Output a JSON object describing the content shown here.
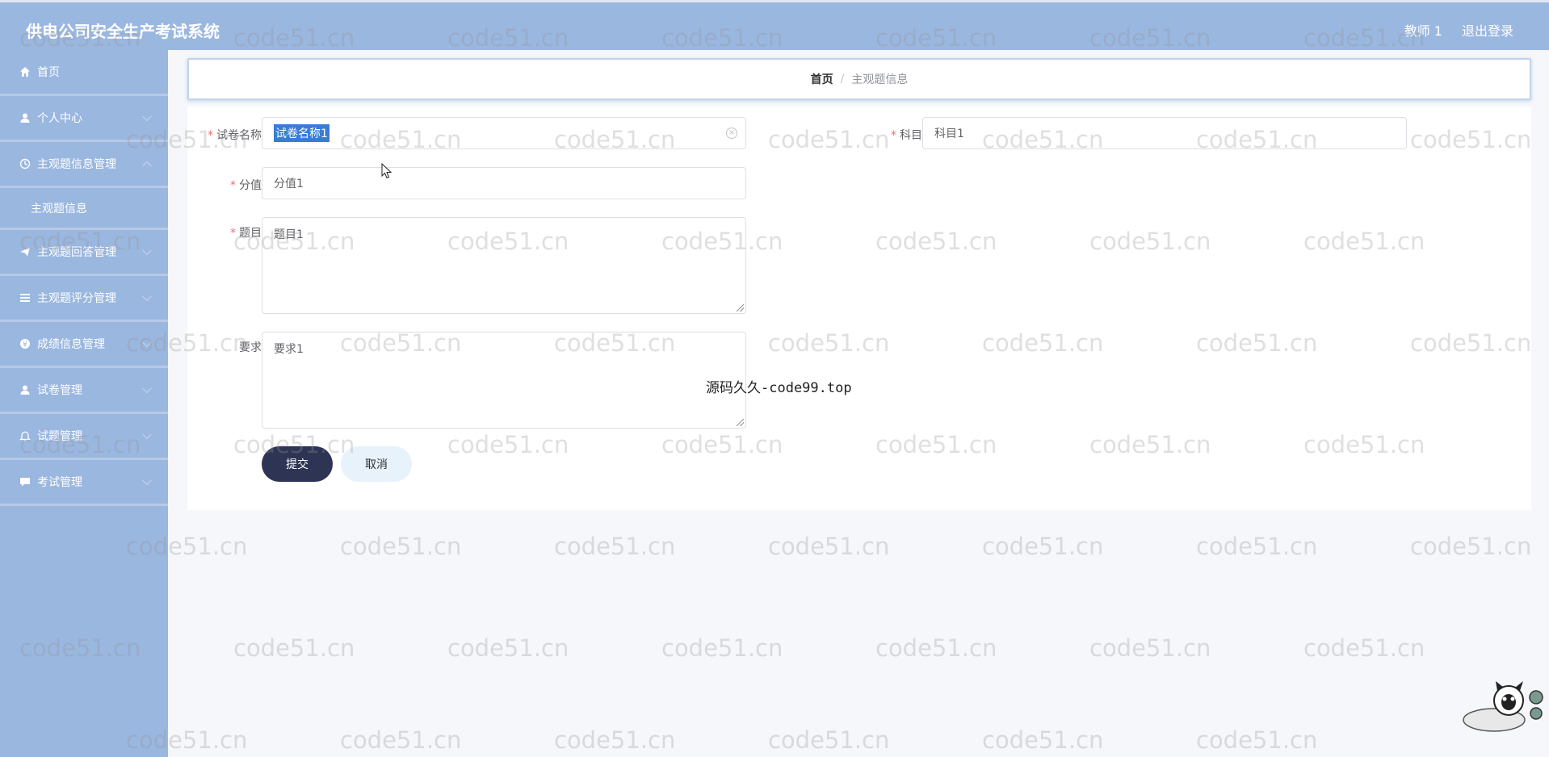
{
  "header": {
    "title": "供电公司安全生产考试系统",
    "user": "教师 1",
    "logout": "退出登录"
  },
  "sidebar": {
    "items": [
      {
        "label": "首页",
        "icon": "home-icon"
      },
      {
        "label": "个人中心",
        "icon": "user-icon"
      },
      {
        "label": "主观题信息管理",
        "icon": "clock-icon",
        "submenu": [
          "主观题信息"
        ]
      },
      {
        "label": "主观题回答管理",
        "icon": "send-icon"
      },
      {
        "label": "主观题评分管理",
        "icon": "list-icon"
      },
      {
        "label": "成绩信息管理",
        "icon": "coin-icon"
      },
      {
        "label": "试卷管理",
        "icon": "user-icon"
      },
      {
        "label": "试题管理",
        "icon": "bell-icon"
      },
      {
        "label": "考试管理",
        "icon": "chat-icon"
      }
    ]
  },
  "breadcrumb": {
    "home": "首页",
    "separator": "/",
    "current": "主观题信息"
  },
  "form": {
    "paper_name": {
      "label": "试卷名称",
      "value": "试卷名称1"
    },
    "subject": {
      "label": "科目",
      "value": "科目1"
    },
    "score": {
      "label": "分值",
      "value": "分值1"
    },
    "question": {
      "label": "题目",
      "value": "题目1"
    },
    "requirement": {
      "label": "要求",
      "value": "要求1"
    },
    "submit_label": "提交",
    "cancel_label": "取消"
  },
  "watermark": {
    "text": "code51.cn",
    "center_text": "源码久久-code99.top"
  },
  "colors": {
    "header_bg": "#9ab7e0",
    "sidebar_bg": "#9ab7e0",
    "submit_bg": "#2e3554",
    "cancel_bg": "#e8f2fb",
    "required": "#f56c6c"
  }
}
